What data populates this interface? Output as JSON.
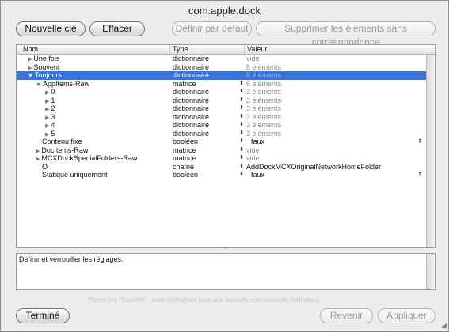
{
  "window": {
    "title": "com.apple.dock"
  },
  "toolbar": {
    "new_key": "Nouvelle clé",
    "clear": "Effacer",
    "set_default": "Définir par défaut",
    "remove_unmatched": "Supprimer les éléments sans correspondance"
  },
  "table": {
    "columns": [
      "Nom",
      "Type",
      "Valeur"
    ],
    "rows": [
      {
        "name": "Une fois",
        "level": 1,
        "disclosure": "collapsed",
        "type": "dictionnaire",
        "value": "vide",
        "value_style": "grey"
      },
      {
        "name": "Souvent",
        "level": 1,
        "disclosure": "collapsed",
        "type": "dictionnaire",
        "value": "8 éléments",
        "value_style": "grey"
      },
      {
        "name": "Toujours",
        "level": 1,
        "disclosure": "expanded",
        "type": "dictionnaire",
        "value": "6 éléments",
        "value_style": "grey",
        "selected": true
      },
      {
        "name": "AppItems-Raw",
        "level": 2,
        "disclosure": "expanded",
        "type": "matrice",
        "value": "6 éléments",
        "value_style": "grey",
        "stepper": true
      },
      {
        "name": "0",
        "level": 3,
        "disclosure": "collapsed",
        "type": "dictionnaire",
        "value": "3 éléments",
        "value_style": "grey",
        "stepper": true
      },
      {
        "name": "1",
        "level": 3,
        "disclosure": "collapsed",
        "type": "dictionnaire",
        "value": "3 éléments",
        "value_style": "grey",
        "stepper": true
      },
      {
        "name": "2",
        "level": 3,
        "disclosure": "collapsed",
        "type": "dictionnaire",
        "value": "3 éléments",
        "value_style": "grey",
        "stepper": true
      },
      {
        "name": "3",
        "level": 3,
        "disclosure": "collapsed",
        "type": "dictionnaire",
        "value": "3 éléments",
        "value_style": "grey",
        "stepper": true
      },
      {
        "name": "4",
        "level": 3,
        "disclosure": "collapsed",
        "type": "dictionnaire",
        "value": "3 éléments",
        "value_style": "grey",
        "stepper": true
      },
      {
        "name": "5",
        "level": 3,
        "disclosure": "collapsed",
        "type": "dictionnaire",
        "value": "3 éléments",
        "value_style": "grey",
        "stepper": true
      },
      {
        "name": "Contenu fixe",
        "level": 2,
        "disclosure": "none",
        "type": "booléen",
        "value": "faux",
        "value_style": "normal",
        "stepper": true,
        "popup": true
      },
      {
        "name": "DocItems-Raw",
        "level": 2,
        "disclosure": "collapsed",
        "type": "matrice",
        "value": "vide",
        "value_style": "grey",
        "stepper": true
      },
      {
        "name": "MCXDockSpecialFolders-Raw",
        "level": 2,
        "disclosure": "collapsed",
        "type": "matrice",
        "value": "vide",
        "value_style": "grey",
        "stepper": true
      },
      {
        "name": "O",
        "level": 2,
        "disclosure": "none",
        "type": "chaîne",
        "value": "AddDockMCXOriginalNetworkHomeFolder",
        "value_style": "normal",
        "stepper": true
      },
      {
        "name": "Statique uniquement",
        "level": 2,
        "disclosure": "none",
        "type": "booléen",
        "value": "faux",
        "value_style": "normal",
        "stepper": true,
        "popup": true
      }
    ]
  },
  "description": {
    "text": "Définir et verrouiller les réglages."
  },
  "footer": {
    "hint": "Placez les \"Souvent\" : sont réinitialisés pour une nouvelle connexion de l'utilisateur",
    "done": "Terminé",
    "revert": "Revenir",
    "apply": "Appliquer"
  }
}
